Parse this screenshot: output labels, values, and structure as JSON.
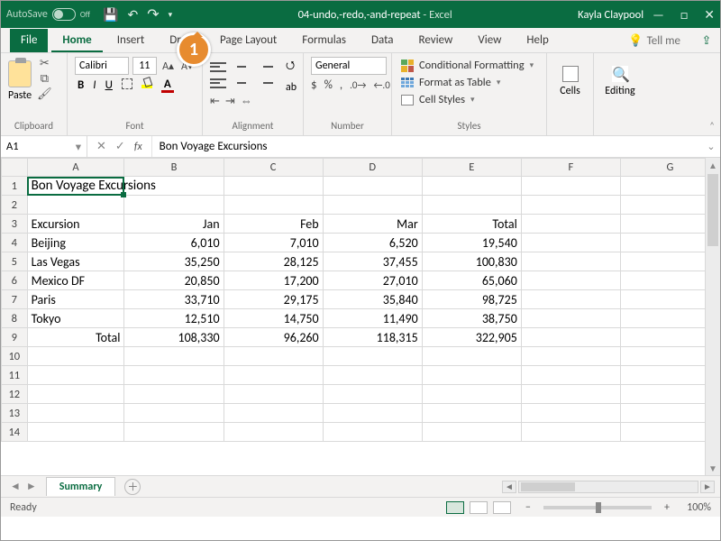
{
  "titlebar": {
    "autosave": "AutoSave",
    "autosave_state": "Off",
    "doc_name": "04-undo,-redo,-and-repeat",
    "app_sep": " - ",
    "app_name": "Excel",
    "user": "Kayla Claypool"
  },
  "tabs": {
    "file": "File",
    "items": [
      "Home",
      "Insert",
      "Draw",
      "Page Layout",
      "Formulas",
      "Data",
      "Review",
      "View",
      "Help"
    ],
    "active": "Home",
    "tellme": "Tell me"
  },
  "ribbon": {
    "clipboard": {
      "paste": "Paste",
      "label": "Clipboard"
    },
    "font": {
      "name": "Calibri",
      "size": "11",
      "label": "Font"
    },
    "alignment": {
      "label": "Alignment"
    },
    "number": {
      "format": "General",
      "label": "Number"
    },
    "styles": {
      "cond": "Conditional Formatting",
      "table": "Format as Table",
      "cell": "Cell Styles",
      "label": "Styles"
    },
    "cells": {
      "label": "Cells"
    },
    "editing": {
      "label": "Editing"
    }
  },
  "formula_bar": {
    "name_box": "A1",
    "formula": "Bon Voyage Excursions"
  },
  "columns": [
    "A",
    "B",
    "C",
    "D",
    "E",
    "F",
    "G"
  ],
  "rows": [
    "1",
    "2",
    "3",
    "4",
    "5",
    "6",
    "7",
    "8",
    "9",
    "10",
    "11",
    "12",
    "13",
    "14"
  ],
  "grid": {
    "title": "Bon Voyage Excursions",
    "header": {
      "a": "Excursion",
      "b": "Jan",
      "c": "Feb",
      "d": "Mar",
      "e": "Total"
    },
    "data": [
      {
        "a": "Beijing",
        "b": "6,010",
        "c": "7,010",
        "d": "6,520",
        "e": "19,540"
      },
      {
        "a": "Las Vegas",
        "b": "35,250",
        "c": "28,125",
        "d": "37,455",
        "e": "100,830"
      },
      {
        "a": "Mexico DF",
        "b": "20,850",
        "c": "17,200",
        "d": "27,010",
        "e": "65,060"
      },
      {
        "a": "Paris",
        "b": "33,710",
        "c": "29,175",
        "d": "35,840",
        "e": "98,725"
      },
      {
        "a": "Tokyo",
        "b": "12,510",
        "c": "14,750",
        "d": "11,490",
        "e": "38,750"
      }
    ],
    "totals": {
      "a": "Total",
      "b": "108,330",
      "c": "96,260",
      "d": "118,315",
      "e": "322,905"
    }
  },
  "sheet_tabs": {
    "active": "Summary"
  },
  "status": {
    "ready": "Ready",
    "zoom_pct": "100%"
  },
  "callout": {
    "n": "1"
  }
}
